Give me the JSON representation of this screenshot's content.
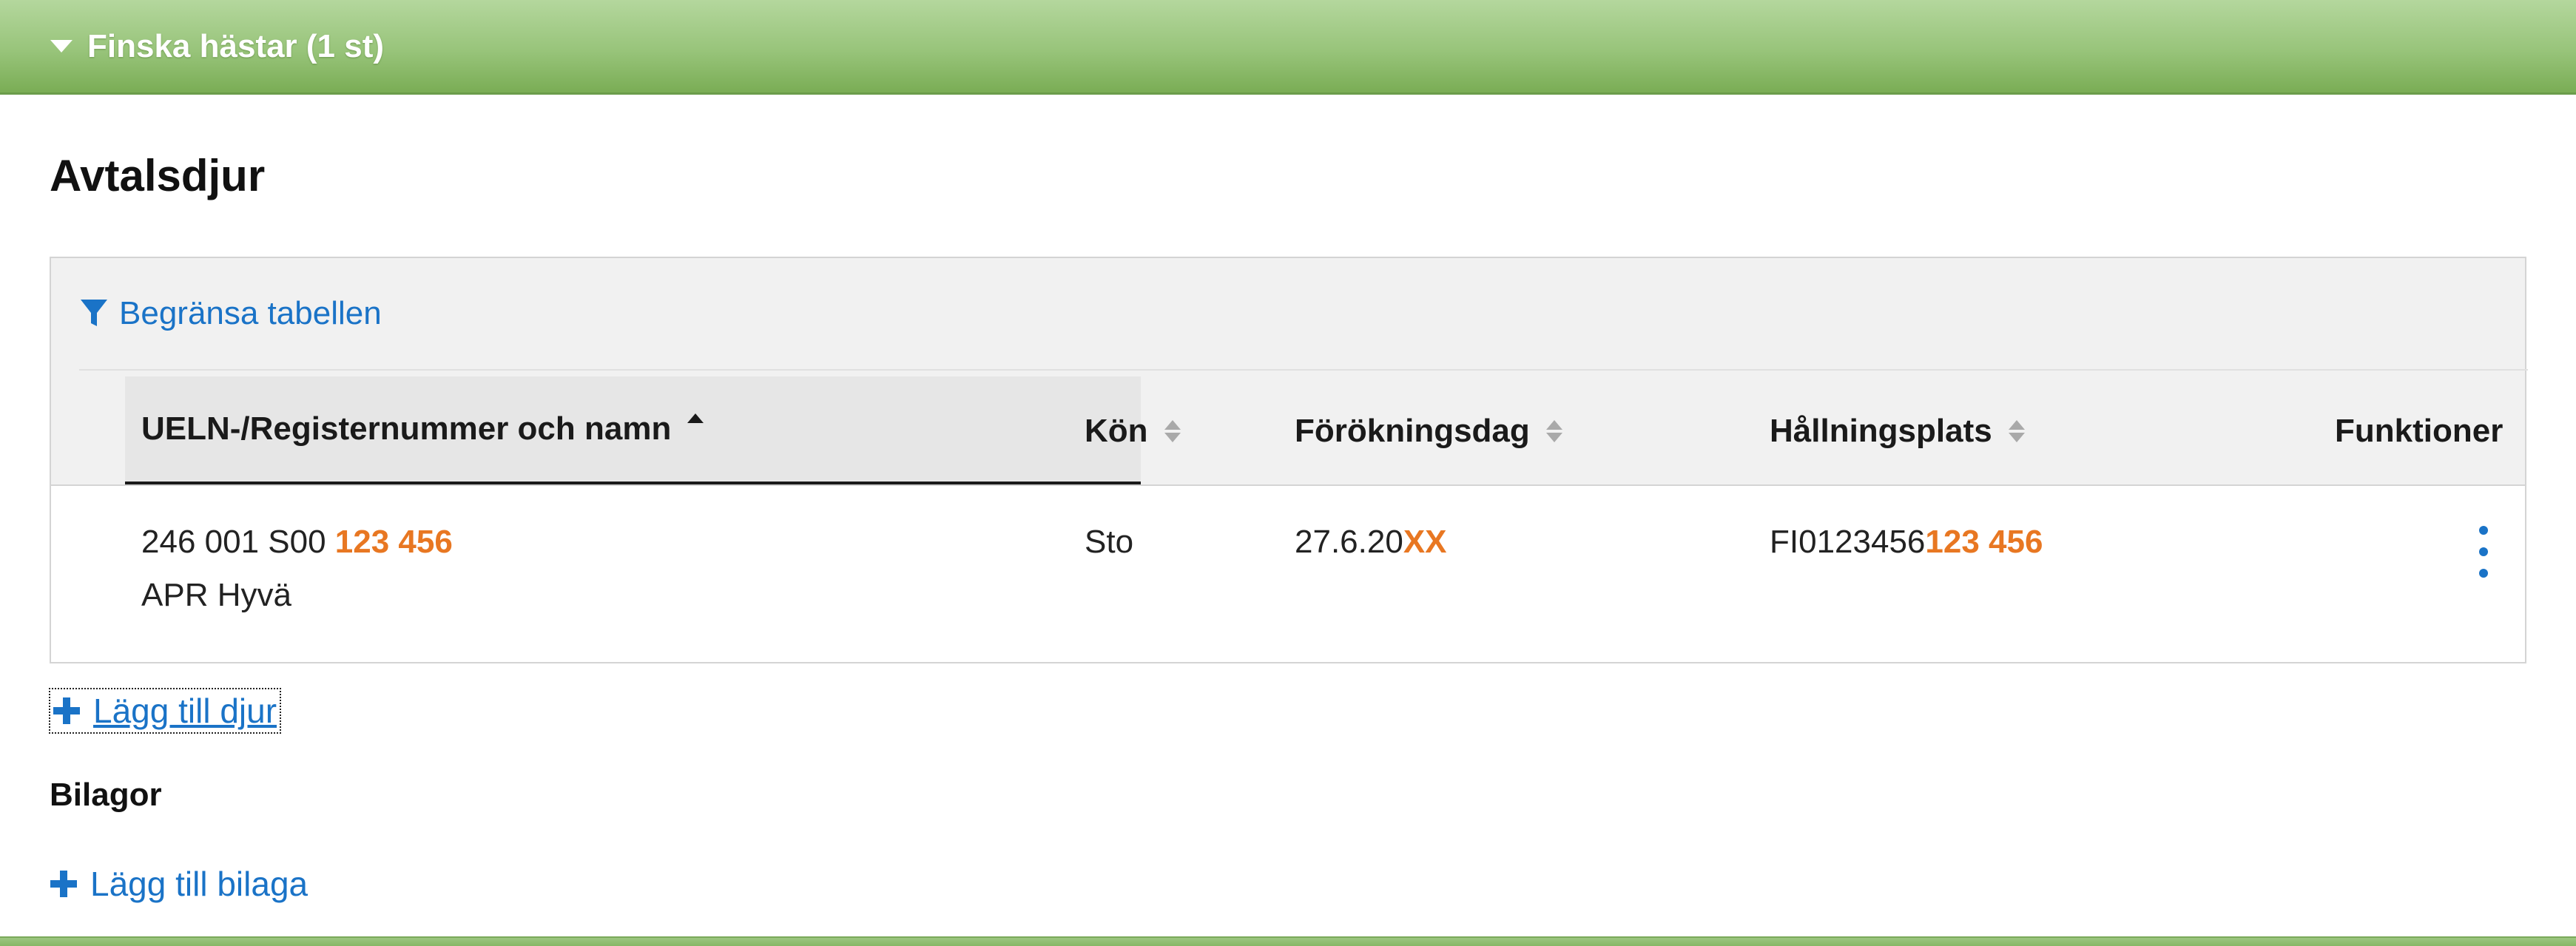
{
  "accordion": {
    "title": "Finska hästar (1 st)",
    "caret_icon": "caret-down-icon"
  },
  "section": {
    "title": "Avtalsdjur"
  },
  "table": {
    "filter_label": "Begränsa tabellen",
    "filter_icon": "filter-icon",
    "columns": [
      {
        "label": "UELN-/Registernummer och namn",
        "sort": "ascending"
      },
      {
        "label": "Kön",
        "sort": "none"
      },
      {
        "label": "Förökningsdag",
        "sort": "none"
      },
      {
        "label": "Hållningsplats",
        "sort": "none"
      },
      {
        "label": "Funktioner",
        "sort": "not-sortable"
      }
    ],
    "rows": [
      {
        "id_prefix": "246 001 S00",
        "id_redacted": "123 456",
        "name": "APR Hyvä",
        "sex": "Sto",
        "breeding_date_prefix": "27.6.20",
        "breeding_date_redacted": "XX",
        "location_prefix": "FI0123456",
        "location_redacted": "123 456",
        "actions_icon": "kebab-menu-icon"
      }
    ]
  },
  "actions": {
    "add_animal": "Lägg till djur",
    "attachments_heading": "Bilagor",
    "add_attachment": "Lägg till bilaga"
  },
  "colors": {
    "accent_blue": "#1a73c7",
    "header_green": "#98c47a",
    "redaction_orange": "#e87722"
  }
}
